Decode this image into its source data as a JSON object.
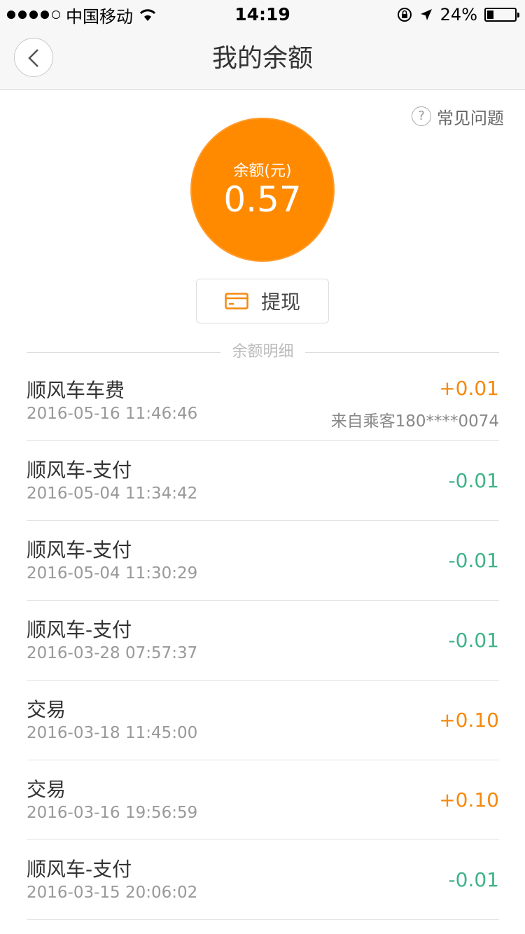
{
  "status_bar": {
    "carrier": "中国移动",
    "time": "14:19",
    "battery": "24%",
    "battery_level": 0.24
  },
  "nav": {
    "title": "我的余额",
    "back_icon": "chevron-left-icon"
  },
  "faq": {
    "icon": "?",
    "label": "常见问题"
  },
  "balance": {
    "label": "余额(元)",
    "value": "0.57"
  },
  "withdraw": {
    "label": "提现",
    "icon": "card-icon",
    "color": "#f5890e"
  },
  "details_section": {
    "title": "余额明细"
  },
  "colors": {
    "accent": "#ff8a00",
    "positive": "#f5890e",
    "negative": "#3fb389"
  },
  "transactions": [
    {
      "title": "顺风车车费",
      "time": "2016-05-16 11:46:46",
      "amount": "+0.01",
      "note": "来自乘客180****0074",
      "direction": "income"
    },
    {
      "title": "顺风车-支付",
      "time": "2016-05-04 11:34:42",
      "amount": "-0.01",
      "direction": "expense"
    },
    {
      "title": "顺风车-支付",
      "time": "2016-05-04 11:30:29",
      "amount": "-0.01",
      "direction": "expense"
    },
    {
      "title": "顺风车-支付",
      "time": "2016-03-28 07:57:37",
      "amount": "-0.01",
      "direction": "expense"
    },
    {
      "title": "交易",
      "time": "2016-03-18 11:45:00",
      "amount": "+0.10",
      "direction": "income"
    },
    {
      "title": "交易",
      "time": "2016-03-16 19:56:59",
      "amount": "+0.10",
      "direction": "income"
    },
    {
      "title": "顺风车-支付",
      "time": "2016-03-15 20:06:02",
      "amount": "-0.01",
      "direction": "expense"
    }
  ]
}
